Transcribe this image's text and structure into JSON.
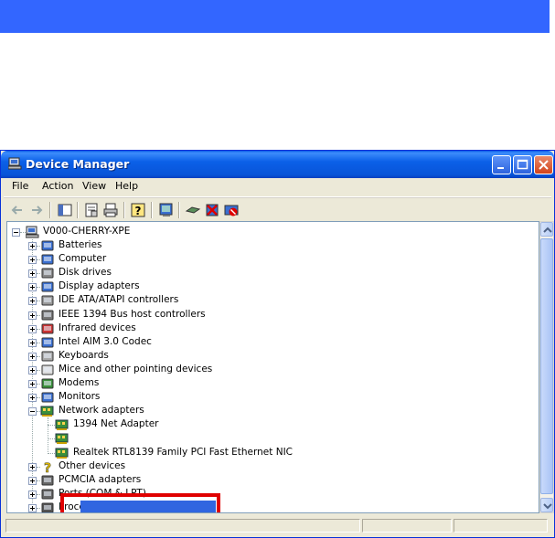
{
  "window": {
    "title": "Device Manager",
    "menu": [
      "File",
      "Action",
      "View",
      "Help"
    ]
  },
  "tree": {
    "root": "V000-CHERRY-XPE",
    "items": [
      {
        "label": "Batteries",
        "icon": "battery-icon"
      },
      {
        "label": "Computer",
        "icon": "computer-icon"
      },
      {
        "label": "Disk drives",
        "icon": "disk-drive-icon"
      },
      {
        "label": "Display adapters",
        "icon": "monitor-icon"
      },
      {
        "label": "IDE ATA/ATAPI controllers",
        "icon": "ide-controller-icon"
      },
      {
        "label": "IEEE 1394 Bus host controllers",
        "icon": "ieee1394-icon"
      },
      {
        "label": "Infrared devices",
        "icon": "infrared-icon"
      },
      {
        "label": "Intel AIM 3.0 Codec",
        "icon": "codec-icon"
      },
      {
        "label": "Keyboards",
        "icon": "keyboard-icon"
      },
      {
        "label": "Mice and other pointing devices",
        "icon": "mouse-icon"
      },
      {
        "label": "Modems",
        "icon": "modem-icon"
      },
      {
        "label": "Monitors",
        "icon": "monitor-icon"
      },
      {
        "label": "Network adapters",
        "icon": "network-adapter-icon",
        "expanded": true
      },
      {
        "label": "1394 Net Adapter",
        "icon": "network-card-icon",
        "child": true
      },
      {
        "label": "",
        "icon": "network-card-icon",
        "child": true,
        "selected": true
      },
      {
        "label": "Realtek RTL8139 Family PCI Fast Ethernet NIC",
        "icon": "network-card-icon",
        "child": true
      },
      {
        "label": "Other devices",
        "icon": "question-icon"
      },
      {
        "label": "PCMCIA adapters",
        "icon": "pcmcia-icon"
      },
      {
        "label": "Ports (COM & LPT)",
        "icon": "port-icon"
      },
      {
        "label": "Processors",
        "icon": "processor-icon"
      }
    ]
  },
  "colors": {
    "top_bar": "#3366ff",
    "highlight_box": "#e00000",
    "selection": "#3166e0"
  }
}
